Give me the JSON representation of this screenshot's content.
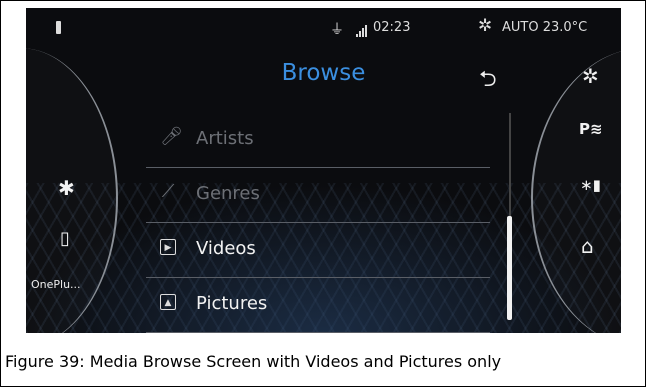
{
  "status_bar": {
    "time": "02:23",
    "climate": "AUTO 23.0°C",
    "icons": [
      "phone-icon",
      "usb-icon",
      "signal-icon",
      "fan-icon"
    ]
  },
  "header": {
    "title": "Browse",
    "back_icon": "back-arrow-icon"
  },
  "browse_list": [
    {
      "label": "Artists",
      "icon": "microphone-icon",
      "enabled": false
    },
    {
      "label": "Genres",
      "icon": "guitar-icon",
      "enabled": false
    },
    {
      "label": "Videos",
      "icon": "video-icon",
      "enabled": true
    },
    {
      "label": "Pictures",
      "icon": "picture-icon",
      "enabled": true
    }
  ],
  "left_panel": {
    "device_label": "OnePlu...",
    "icons": [
      "settings-gear-icon",
      "phone-media-icon"
    ]
  },
  "right_panel": {
    "icons": [
      "fan-icon",
      "parking-sensor-icon",
      "bluetooth-battery-icon",
      "home-icon"
    ]
  },
  "scroll": {
    "position": 0.9
  },
  "caption": "Figure 39: Media Browse Screen with Videos and Pictures only",
  "colors": {
    "title": "#3b8fe0",
    "background": "#0b0c0f",
    "disabled_text": "#6d7076",
    "enabled_text": "#f2f2f2"
  }
}
